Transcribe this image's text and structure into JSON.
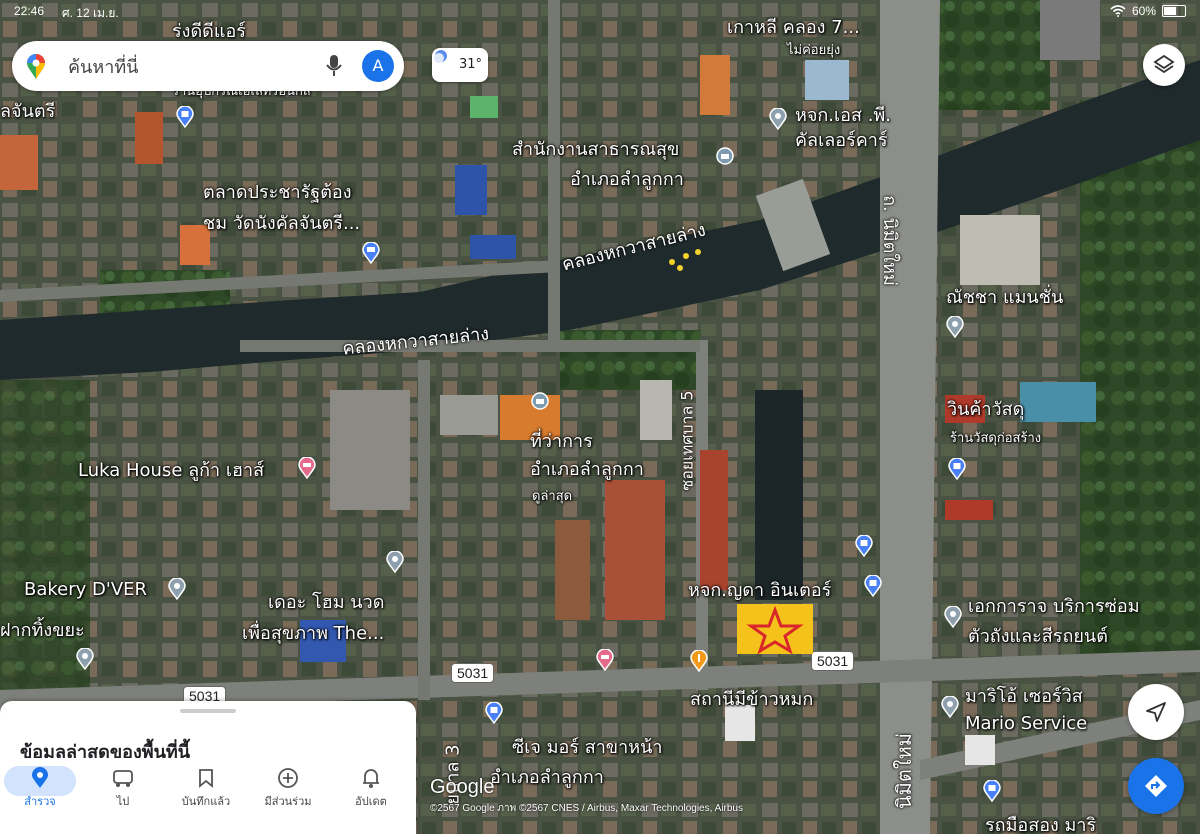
{
  "status": {
    "time": "22:46",
    "date": "ศ. 12 เม.ย.",
    "battery": "60%",
    "battery_level": 0.6
  },
  "search": {
    "placeholder": "ค้นหาที่นี่",
    "avatar_letter": "A"
  },
  "weather": {
    "temp": "31°"
  },
  "sheet": {
    "title": "ข้อมูลล่าสุดของพื้นที่นี้"
  },
  "nav": [
    {
      "label": "สำรวจ",
      "icon": "explore-pin-icon",
      "active": true
    },
    {
      "label": "ไป",
      "icon": "commute-icon",
      "active": false
    },
    {
      "label": "บันทึกแล้ว",
      "icon": "bookmark-icon",
      "active": false
    },
    {
      "label": "มีส่วนร่วม",
      "icon": "contribute-plus-icon",
      "active": false
    },
    {
      "label": "อัปเดต",
      "icon": "bell-icon",
      "active": false
    }
  ],
  "map": {
    "labels": {
      "ringdee": "ร่งดีดีแอร์",
      "shop_tools": "ร้านอุปกรณ์เอเลทรอนิกส์",
      "chantri": "ลจันตรี",
      "market": "ตลาดประชารัฐต้อง",
      "market2": "ชม วัดนังคัลจันตรี...",
      "korea_clong": "เกาหลี คลอง 7...",
      "maikoi": "ไม่ค่อยยุ่ง",
      "hjk_sp": "หจก.เอส .พี.",
      "color_car": "คัลเลอร์คาร์",
      "health_office": "สำนักงานสาธารณสุข",
      "lamlukka_dist": "อำเภอลำลูกกา",
      "canal_upper": "คลองหกวาสายล่าง",
      "canal_lower": "คลองหกวาสายล่าง",
      "nimit_road_top": "ถ. นิมิตใหม่",
      "natcha": "ณัชชา แมนชั่น",
      "win_material": "วินค้าวัสดุ",
      "material_shop": "ร้านวัสดุก่อสร้าง",
      "district_office": "ที่ว่าการ",
      "district_office2": "อำเภอลำลูกกา",
      "latest": "ดูล่าสุด",
      "soi5": "ซอยเทศบาล 5",
      "luka_house": "Luka House ลูก้า เฮาส์",
      "bakery": "Bakery D'VER",
      "the_home": "เดอะ โฮม นวด",
      "the_home2": "เพื่อสุขภาพ The...",
      "hjk_yada": "หจก.ญดา อินเตอร์",
      "garbage": "ฝากทิ้งขยะ",
      "repair": "เอกการาจ บริการซ่อม",
      "repair2": "ตัวถังและสีรถยนต์",
      "station_rice": "สถานีมีข้าวหมก",
      "mario": "มาริโอ้ เซอร์วิส",
      "mario2": "Mario Service",
      "cj": "ซีเจ มอร์ สาขาหน้า",
      "cj2": "อำเภอลำลูกกา",
      "soi3": "ยบาล 3",
      "nimit_road_bottom": "นิมิตใหม่",
      "second_hand": "รถมือสอง มาริ"
    },
    "route_shields": [
      "5031",
      "5031",
      "5031"
    ]
  },
  "attribution": {
    "google": "Google",
    "credit": "©2567 Google ภาพ ©2567 CNES / Airbus, Maxar Technologies, Airbus"
  }
}
